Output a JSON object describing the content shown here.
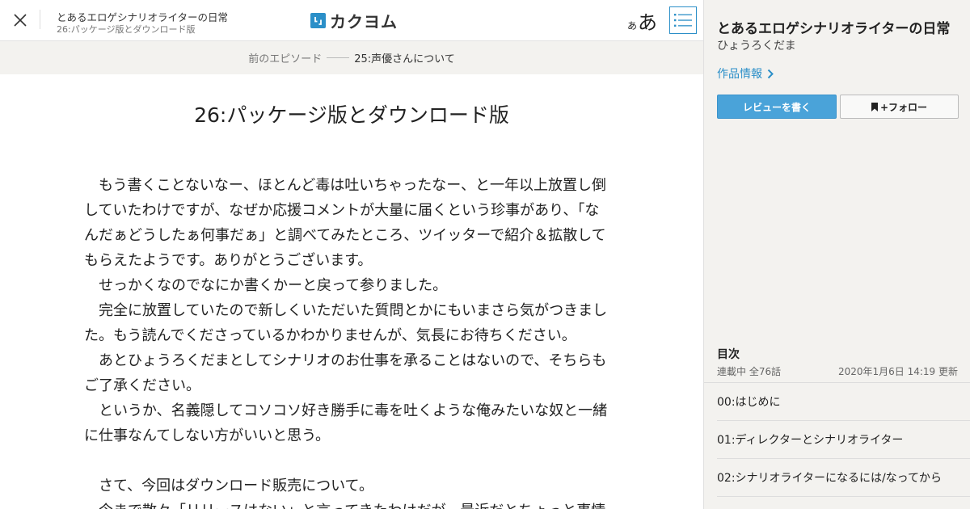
{
  "header": {
    "work_title": "とあるエロゲシナリオライターの日常",
    "episode_subtitle": "26:パッケージ版とダウンロード版",
    "logo_text": "カクヨム",
    "font_size_small": "あ",
    "font_size_large": "あ",
    "icons": {
      "close": "close-icon",
      "toc": "list-icon",
      "logo": "kakuyomu-logo-mark"
    }
  },
  "episode_nav": {
    "prev_label": "前のエピソード",
    "prev_title": "25:声優さんについて"
  },
  "episode": {
    "title": "26:パッケージ版とダウンロード版",
    "paragraphs": [
      "　もう書くことないなー、ほとんど毒は吐いちゃったなー、と一年以上放置し倒していたわけですが、なぜか応援コメントが大量に届くという珍事があり、「なんだぁどうしたぁ何事だぁ」と調べてみたところ、ツイッターで紹介＆拡散してもらえたようです。ありがとうございます。",
      "　せっかくなのでなにか書くかーと戻って参りました。",
      "　完全に放置していたので新しくいただいた質問とかにもいまさら気がつきました。もう読んでくださっているかわかりませんが、気長にお待ちください。",
      "　あとひょうろくだまとしてシナリオのお仕事を承ることはないので、そちらもご了承ください。",
      "　というか、名義隠してコソコソ好き勝手に毒を吐くような俺みたいな奴と一緒に仕事なんてしない方がいいと思う。",
      "",
      "　さて、今回はダウンロード販売について。",
      "　今まで散々「リリースはない」と言ってきたわけだが、最近だとちょっと事情"
    ]
  },
  "sidebar": {
    "title": "とあるエロゲシナリオライターの日常",
    "author": "ひょうろくだま",
    "info_link": "作品情報",
    "review_button": "レビューを書く",
    "follow_button": "+フォロー",
    "toc_heading": "目次",
    "toc_status": "連載中 全76話",
    "toc_updated": "2020年1月6日 14:19 更新",
    "toc_items": [
      "00:はじめに",
      "01:ディレクターとシナリオライター",
      "02:シナリオライターになるには/なってから"
    ],
    "icons": {
      "info_chevron": "chevron-right-icon",
      "follow": "bookmark-icon"
    }
  },
  "colors": {
    "accent": "#2b8fc8",
    "review_button_bg": "#4aa3d9",
    "sidebar_bg": "#f3f2ef",
    "nav_bg": "#f3f2ef"
  }
}
